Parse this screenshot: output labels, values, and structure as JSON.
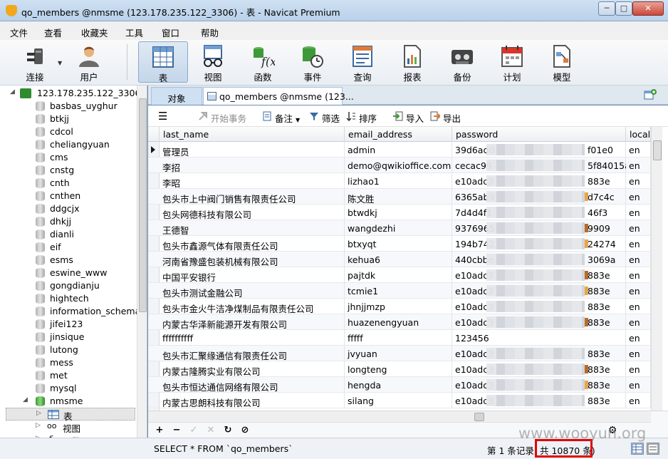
{
  "window": {
    "title": "qo_members @nmsme (123.178.235.122_3306) - 表 - Navicat Premium",
    "controls": {
      "minimize": "─",
      "maximize": "□",
      "close": "✕"
    }
  },
  "menu": [
    "文件",
    "查看",
    "收藏夹",
    "工具",
    "窗口",
    "帮助"
  ],
  "toolbar": {
    "connect": "连接",
    "user": "用户",
    "buttons": [
      "表",
      "视图",
      "函数",
      "事件",
      "查询",
      "报表",
      "备份",
      "计划",
      "模型"
    ],
    "active": "表"
  },
  "tree": {
    "connection": "123.178.235.122_3306",
    "databases": [
      "basbas_uyghur",
      "btkjj",
      "cdcol",
      "cheliangyuan",
      "cms",
      "cnstg",
      "cnth",
      "cnthen",
      "ddgcjx",
      "dhkjj",
      "dianli",
      "eif",
      "esms",
      "eswine_www",
      "gongdianju",
      "hightech",
      "information_schema",
      "jifei123",
      "jinsique",
      "lutong",
      "mess",
      "met",
      "mysql"
    ],
    "open_db": "nmsme",
    "children": [
      "表",
      "视图",
      "函数"
    ]
  },
  "tabs": {
    "objects": "对象",
    "table_tab": "qo_members @nmsme (123..."
  },
  "content_toolbar": {
    "menu_glyph": "☰",
    "begin_tx": "开始事务",
    "memo": "备注",
    "filter": "筛选",
    "sort": "排序",
    "import": "导入",
    "export": "导出"
  },
  "grid": {
    "columns": [
      "last_name",
      "email_address",
      "password",
      "locale"
    ],
    "rows": [
      [
        "管理员",
        "admin",
        "39d6ad0",
        "f01e0",
        "en"
      ],
      [
        "李招",
        "demo@qwikioffice.com",
        "cecac99",
        "5f84015a",
        "en"
      ],
      [
        "李昭",
        "lizhao1",
        "e10adc3",
        "883e",
        "en"
      ],
      [
        "包头市上中阀门销售有限责任公司",
        "陈文胜",
        "6365ab9",
        "d7c4c",
        "en"
      ],
      [
        "包头网德科技有限公司",
        "btwdkj",
        "7d4d4f1",
        "46f3",
        "en"
      ],
      [
        "王德智",
        "wangdezhi",
        "9376965",
        "9909",
        "en"
      ],
      [
        "包头市鑫源气体有限责任公司",
        "btxyqt",
        "194b742",
        "24274",
        "en"
      ],
      [
        "河南省豫盛包装机械有限公司",
        "kehua6",
        "440cbbe",
        "3069a",
        "en"
      ],
      [
        "中国平安银行",
        "pajtdk",
        "e10adc3",
        "883e",
        "en"
      ],
      [
        "包头市测试金融公司",
        "tcmie1",
        "e10adc3",
        "883e",
        "en"
      ],
      [
        "包头市金火牛洁净煤制品有限责任公司",
        "jhnjjmzp",
        "e10adc3",
        "883e",
        "en"
      ],
      [
        "内蒙古华泽新能源开发有限公司",
        "huazenengyuan",
        "e10adc3",
        "883e",
        "en"
      ],
      [
        "ffffffffff",
        "fffff",
        "123456",
        "",
        "en"
      ],
      [
        "包头市汇聚缘通信有限责任公司",
        "jvyuan",
        "e10adc3",
        "883e",
        "en"
      ],
      [
        "内蒙古隆腾实业有限公司",
        "longteng",
        "e10adc3",
        "883e",
        "en"
      ],
      [
        " 包头市恒达通信网络有限公司",
        "hengda",
        "e10adc3",
        "883e",
        "en"
      ],
      [
        "内蒙古思朗科技有限公司",
        "silang",
        "e10adc3",
        "883e",
        "en"
      ]
    ],
    "marked_row": 0
  },
  "bottom_nav": [
    "+",
    "−",
    "✓",
    "✕",
    "↻",
    "⊘"
  ],
  "status": {
    "sql": "SELECT * FROM `qo_members`",
    "record": "第 1 条记录",
    "count": "共 10870 条)"
  },
  "watermark": "www.wooyun.org",
  "colors": {
    "titlebar": "#bcd3ea",
    "accent": "#2e8b2e",
    "highlight": "#e10000"
  }
}
